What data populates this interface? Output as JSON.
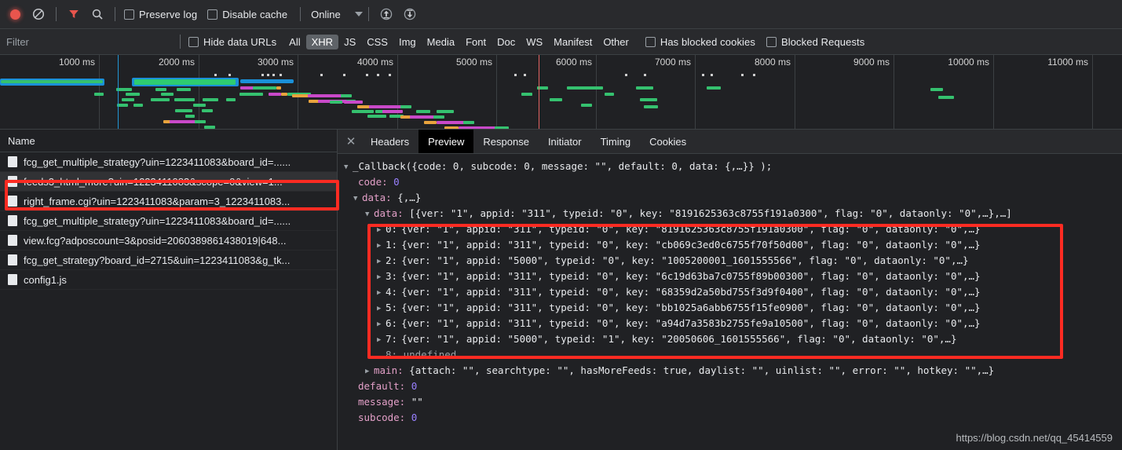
{
  "toolbar": {
    "record_icon": "record-dot-icon",
    "clear_icon": "clear-no-entry-icon",
    "filter_icon": "filter-funnel-icon",
    "search_icon": "search-magnifier-icon",
    "preserve_log_label": "Preserve log",
    "disable_cache_label": "Disable cache",
    "throttle_value": "Online",
    "throttle_caret_icon": "chevron-down-icon",
    "import_icon": "import-har-up-arrow-icon",
    "export_icon": "export-har-down-arrow-icon"
  },
  "filterbar": {
    "filter_placeholder": "Filter",
    "hide_data_urls_label": "Hide data URLs",
    "types": [
      {
        "label": "All",
        "active": false
      },
      {
        "label": "XHR",
        "active": true
      },
      {
        "label": "JS",
        "active": false
      },
      {
        "label": "CSS",
        "active": false
      },
      {
        "label": "Img",
        "active": false
      },
      {
        "label": "Media",
        "active": false
      },
      {
        "label": "Font",
        "active": false
      },
      {
        "label": "Doc",
        "active": false
      },
      {
        "label": "WS",
        "active": false
      },
      {
        "label": "Manifest",
        "active": false
      },
      {
        "label": "Other",
        "active": false
      }
    ],
    "has_blocked_cookies_label": "Has blocked cookies",
    "blocked_requests_label": "Blocked Requests"
  },
  "overview": {
    "ticks": [
      "1000 ms",
      "2000 ms",
      "3000 ms",
      "4000 ms",
      "5000 ms",
      "6000 ms",
      "7000 ms",
      "8000 ms",
      "9000 ms",
      "10000 ms",
      "11000 ms"
    ]
  },
  "requests": {
    "column_header": "Name",
    "items": [
      {
        "name": "fcg_get_multiple_strategy?uin=1223411083&board_id=......",
        "selected": false
      },
      {
        "name": "feeds3_html_more?uin=1223411083&scope=0&view=1...",
        "selected": true
      },
      {
        "name": "right_frame.cgi?uin=1223411083&param=3_1223411083...",
        "selected": false
      },
      {
        "name": "fcg_get_multiple_strategy?uin=1223411083&board_id=......",
        "selected": false
      },
      {
        "name": "view.fcg?adposcount=3&posid=2060389861438019|648...",
        "selected": false
      },
      {
        "name": "fcg_get_strategy?board_id=2715&uin=1223411083&g_tk...",
        "selected": false
      },
      {
        "name": "config1.js",
        "selected": false
      }
    ]
  },
  "detail": {
    "close_icon": "close-x-icon",
    "tabs": [
      {
        "label": "Headers",
        "active": false
      },
      {
        "label": "Preview",
        "active": true
      },
      {
        "label": "Response",
        "active": false
      },
      {
        "label": "Initiator",
        "active": false
      },
      {
        "label": "Timing",
        "active": false
      },
      {
        "label": "Cookies",
        "active": false
      }
    ]
  },
  "preview": {
    "root_line": "_Callback({code: 0, subcode: 0, message: \"\", default: 0, data: {,…}} );",
    "code_key": "code:",
    "code_value": "0",
    "data_key": "data:",
    "data_value": "{,…}",
    "inner_data_key": "data:",
    "inner_data_value": "[{ver: \"1\", appid: \"311\", typeid: \"0\", key: \"8191625363c8755f191a0300\", flag: \"0\", dataonly: \"0\",…},…]",
    "array_items": [
      {
        "index": "0:",
        "value": "{ver: \"1\", appid: \"311\", typeid: \"0\", key: \"8191625363c8755f191a0300\", flag: \"0\", dataonly: \"0\",…}"
      },
      {
        "index": "1:",
        "value": "{ver: \"1\", appid: \"311\", typeid: \"0\", key: \"cb069c3ed0c6755f70f50d00\", flag: \"0\", dataonly: \"0\",…}"
      },
      {
        "index": "2:",
        "value": "{ver: \"1\", appid: \"5000\", typeid: \"0\", key: \"1005200001_1601555566\", flag: \"0\", dataonly: \"0\",…}"
      },
      {
        "index": "3:",
        "value": "{ver: \"1\", appid: \"311\", typeid: \"0\", key: \"6c19d63ba7c0755f89b00300\", flag: \"0\", dataonly: \"0\",…}"
      },
      {
        "index": "4:",
        "value": "{ver: \"1\", appid: \"311\", typeid: \"0\", key: \"68359d2a50bd755f3d9f0400\", flag: \"0\", dataonly: \"0\",…}"
      },
      {
        "index": "5:",
        "value": "{ver: \"1\", appid: \"311\", typeid: \"0\", key: \"bb1025a6abb6755f15fe0900\", flag: \"0\", dataonly: \"0\",…}"
      },
      {
        "index": "6:",
        "value": "{ver: \"1\", appid: \"311\", typeid: \"0\", key: \"a94d7a3583b2755fe9a10500\", flag: \"0\", dataonly: \"0\",…}"
      },
      {
        "index": "7:",
        "value": "{ver: \"1\", appid: \"5000\", typeid: \"1\", key: \"20050606_1601555566\", flag: \"0\", dataonly: \"0\",…}"
      }
    ],
    "undefined_index": "8:",
    "undefined_value": "undefined",
    "main_key": "main:",
    "main_value": "{attach: \"\", searchtype: \"\", hasMoreFeeds: true, daylist: \"\", uinlist: \"\", error: \"\", hotkey: \"\",…}",
    "default_key": "default:",
    "default_value": "0",
    "message_key": "message:",
    "message_value": "\"\"",
    "subcode_key": "subcode:",
    "subcode_value": "0"
  },
  "watermark": "https://blog.csdn.net/qq_45414559",
  "colors": {
    "accent_red": "#fd2b22",
    "record_red": "#e8554d",
    "active_tab_bg": "#000000",
    "panel_bg": "#202124",
    "toolbar_bg": "#292a2d",
    "waterfall_green": "#35c16f",
    "waterfall_magenta": "#c949c9",
    "waterfall_orange": "#e8a33d",
    "waterfall_blue": "#1a90d8"
  }
}
